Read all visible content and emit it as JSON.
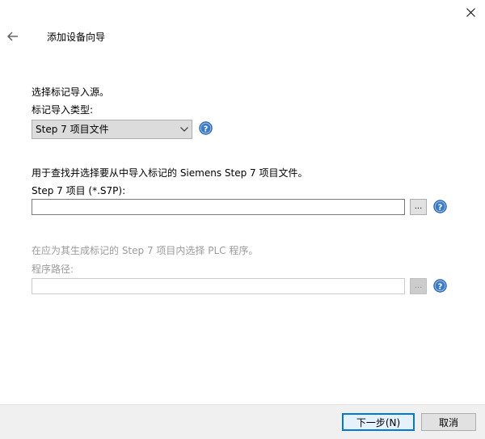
{
  "window": {
    "title": "添加设备向导",
    "close_glyph": "✕",
    "back_glyph": "←"
  },
  "source_section": {
    "heading": "选择标记导入源。",
    "type_label": "标记导入类型:",
    "type_selected": "Step 7 项目文件"
  },
  "project_section": {
    "description": "用于查找并选择要从中导入标记的 Siemens Step 7 项目文件。",
    "label": "Step 7 项目 (*.S7P):",
    "value": "",
    "browse_label": "..."
  },
  "program_section": {
    "description": "在应为其生成标记的 Step 7 项目内选择 PLC 程序。",
    "label": "程序路径:",
    "value": "",
    "browse_label": "..."
  },
  "footer": {
    "next_label": "下一步(N)",
    "cancel_label": "取消"
  },
  "colors": {
    "help_icon_fill": "#3b7bc4",
    "primary_button_border": "#0078d7",
    "disabled_text": "#9b9b9b",
    "footer_background": "#f0f0f0"
  },
  "icons": {
    "close": "close-icon",
    "back": "back-arrow-icon",
    "dropdown": "chevron-down-icon",
    "help": "help-icon"
  }
}
